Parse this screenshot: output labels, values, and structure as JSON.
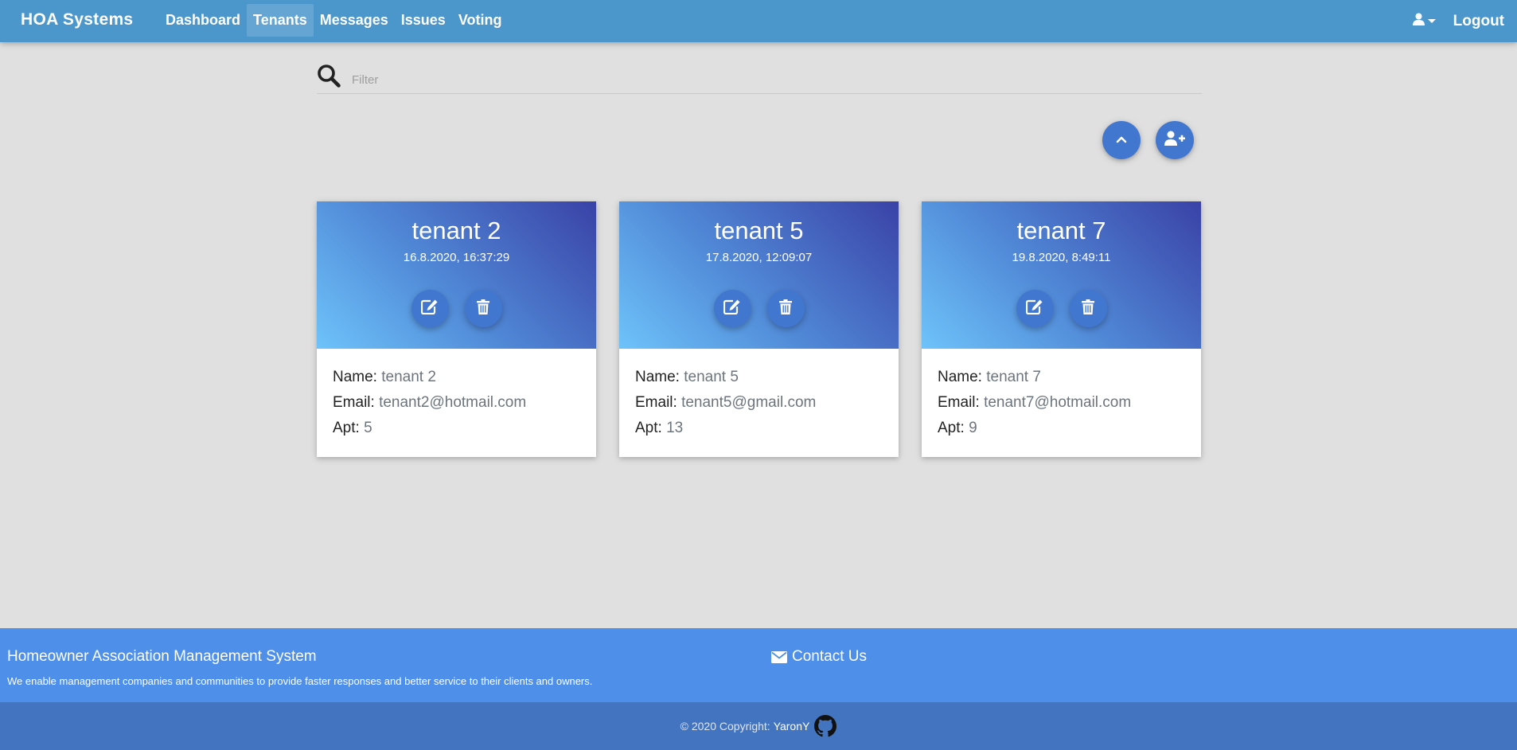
{
  "navbar": {
    "brand": "HOA Systems",
    "links": [
      {
        "label": "Dashboard",
        "active": false
      },
      {
        "label": "Tenants",
        "active": true
      },
      {
        "label": "Messages",
        "active": false
      },
      {
        "label": "Issues",
        "active": false
      },
      {
        "label": "Voting",
        "active": false
      }
    ],
    "logout_label": "Logout",
    "user_icon": "user-icon"
  },
  "filter": {
    "placeholder": "Filter",
    "value": "",
    "icon": "search-icon"
  },
  "actions": {
    "scroll_top_icon": "chevron-up-icon",
    "add_tenant_icon": "user-plus-icon"
  },
  "labels": {
    "name": "Name:",
    "email": "Email:",
    "apt": "Apt:"
  },
  "tenants": [
    {
      "title": "tenant 2",
      "date": "16.8.2020, 16:37:29",
      "name": "tenant 2",
      "email": "tenant2@hotmail.com",
      "apt": "5"
    },
    {
      "title": "tenant 5",
      "date": "17.8.2020, 12:09:07",
      "name": "tenant 5",
      "email": "tenant5@gmail.com",
      "apt": "13"
    },
    {
      "title": "tenant 7",
      "date": "19.8.2020, 8:49:11",
      "name": "tenant 7",
      "email": "tenant7@hotmail.com",
      "apt": "9"
    }
  ],
  "footer": {
    "title": "Homeowner Association Management System",
    "description": "We enable management companies and communities to provide faster responses and better service to their clients and owners.",
    "contact_label": "Contact Us",
    "copyright": "© 2020 Copyright:",
    "author": "YaronY"
  },
  "colors": {
    "navbar": "#4b97cc",
    "accent": "#4277d0",
    "footer_top": "#4d8fe9",
    "footer_bottom": "#4274c0",
    "background": "#e0e0e0"
  }
}
